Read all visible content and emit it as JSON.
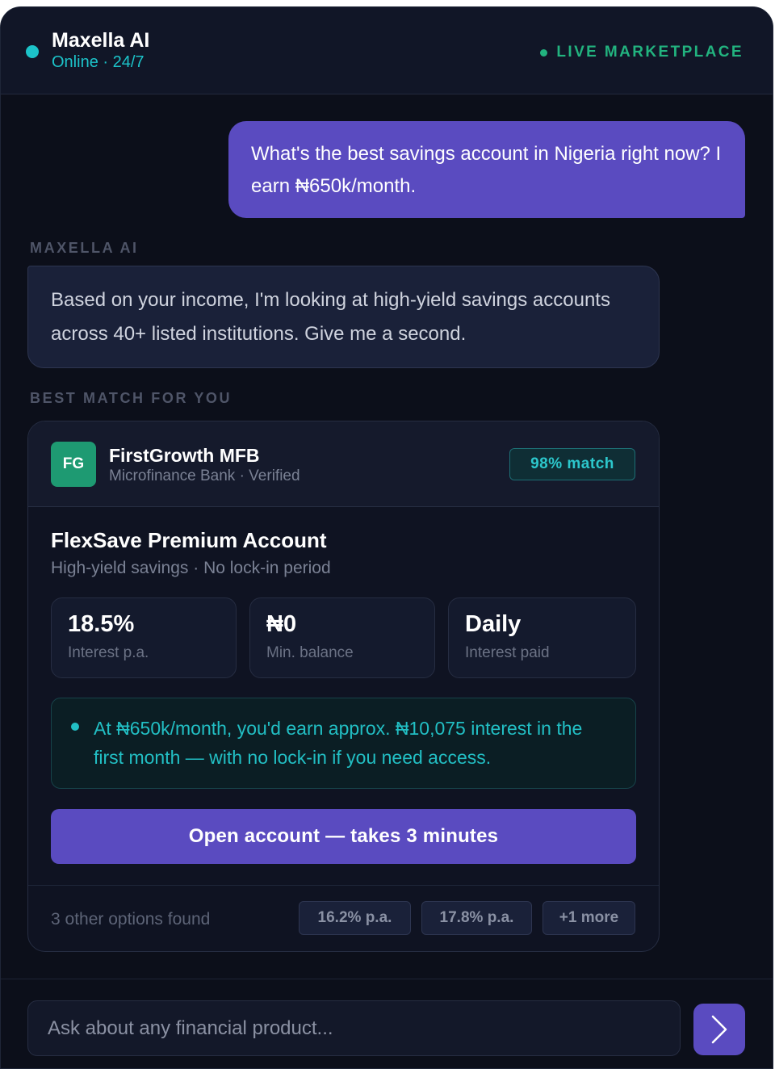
{
  "header": {
    "agent_name": "Maxella AI",
    "agent_status": "Online · 24/7",
    "live_label": "LIVE MARKETPLACE"
  },
  "conversation": {
    "user_message": "What's the best savings account in Nigeria right now? I earn ₦650k/month.",
    "ai_label": "MAXELLA AI",
    "ai_message": "Based on your income, I'm looking at high-yield savings accounts across 40+ listed institutions. Give me a second.",
    "match_label": "BEST MATCH FOR YOU"
  },
  "card": {
    "bank_logo_text": "FG",
    "bank_name": "FirstGrowth MFB",
    "bank_subtitle": "Microfinance Bank · Verified",
    "match_badge": "98% match",
    "product_title": "FlexSave Premium Account",
    "product_subtitle": "High-yield savings · No lock-in period",
    "stats": [
      {
        "value": "18.5%",
        "label": "Interest p.a."
      },
      {
        "value": "₦0",
        "label": "Min. balance"
      },
      {
        "value": "Daily",
        "label": "Interest paid"
      }
    ],
    "insight": "At ₦650k/month, you'd earn approx. ₦10,075 interest in the first month — with no lock-in if you need access.",
    "cta_label": "Open account — takes 3 minutes",
    "other_options_label": "3 other options found",
    "other_options": [
      "16.2% p.a.",
      "17.8% p.a.",
      "+1 more"
    ]
  },
  "composer": {
    "placeholder": "Ask about any financial product...",
    "send_icon": "chevron-right-icon"
  },
  "colors": {
    "accent": "#5a4bc0",
    "teal": "#1cc3c9",
    "green": "#22b37f",
    "background": "#0c0f1a"
  }
}
